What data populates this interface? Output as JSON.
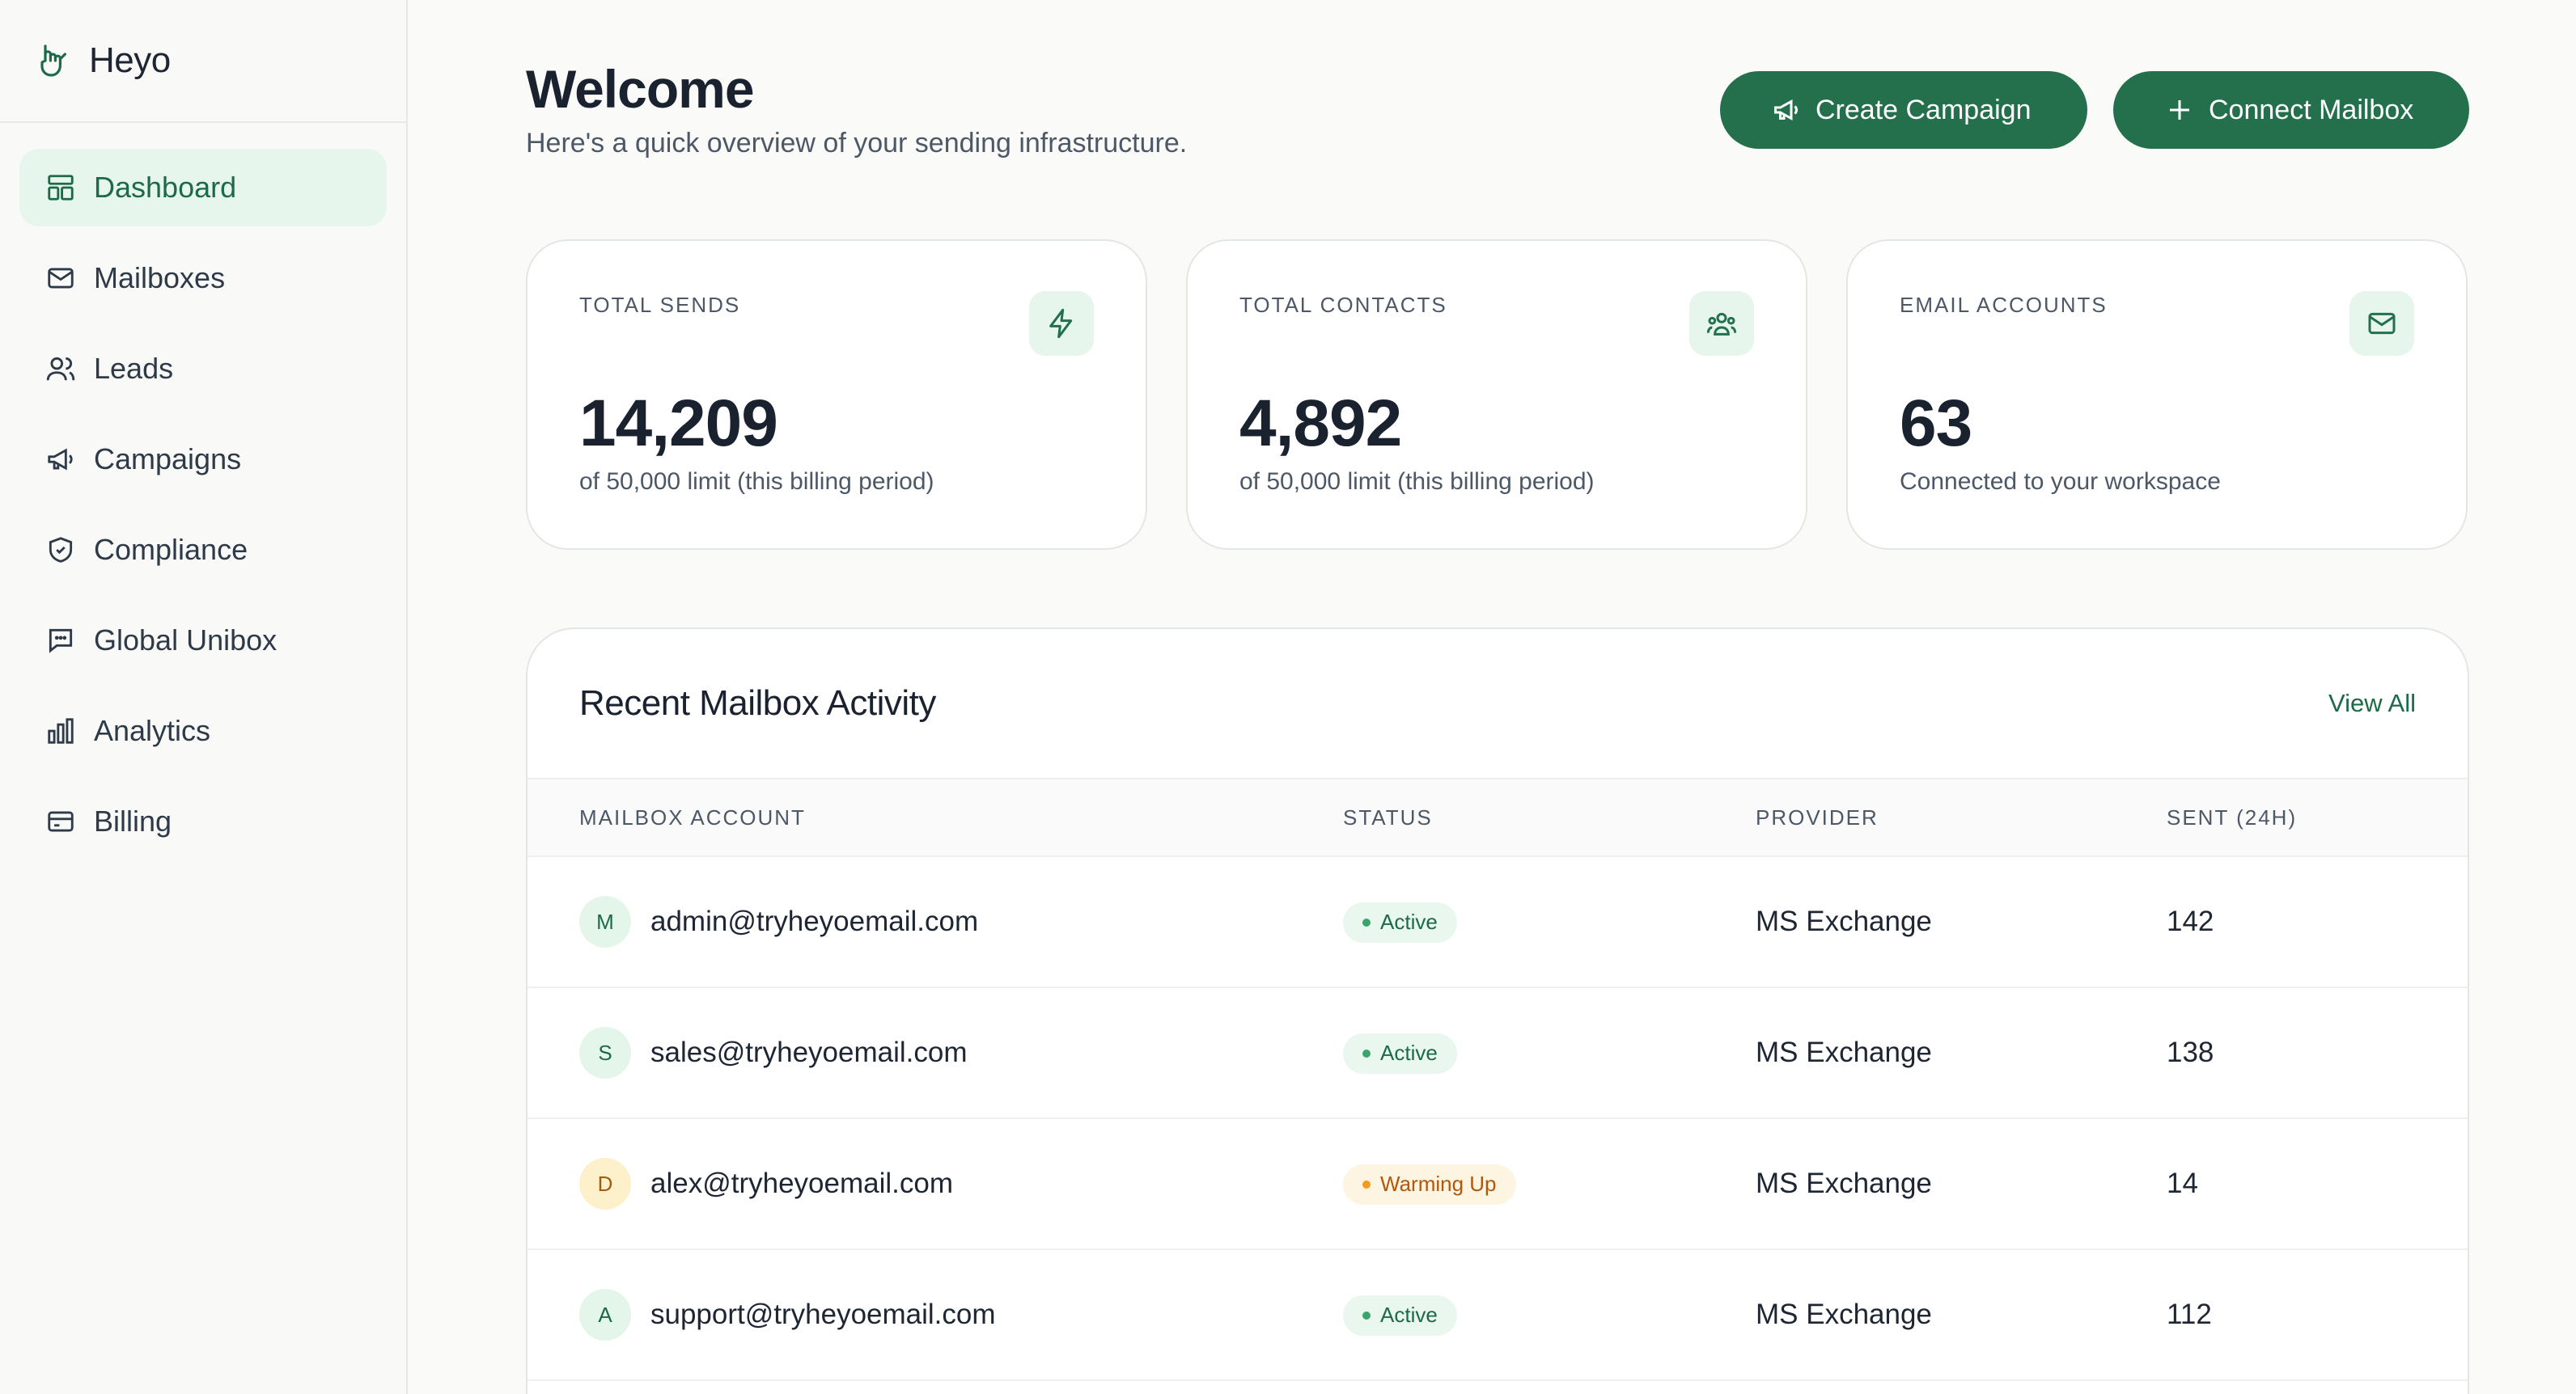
{
  "brand": {
    "name": "Heyo",
    "icon": "hand-icon"
  },
  "sidebar": {
    "items": [
      {
        "label": "Dashboard",
        "icon": "dashboard-icon",
        "active": true
      },
      {
        "label": "Mailboxes",
        "icon": "mail-icon"
      },
      {
        "label": "Leads",
        "icon": "users-icon"
      },
      {
        "label": "Campaigns",
        "icon": "megaphone-icon"
      },
      {
        "label": "Compliance",
        "icon": "shield-icon"
      },
      {
        "label": "Global Unibox",
        "icon": "chat-icon"
      },
      {
        "label": "Analytics",
        "icon": "bar-chart-icon"
      },
      {
        "label": "Billing",
        "icon": "credit-card-icon"
      }
    ]
  },
  "header": {
    "title": "Welcome",
    "subtitle": "Here's a quick overview of your sending infrastructure.",
    "create_label": "Create Campaign",
    "connect_label": "Connect Mailbox"
  },
  "stats": [
    {
      "label": "TOTAL SENDS",
      "value": "14,209",
      "sub": "of 50,000 limit (this billing period)",
      "icon": "lightning-icon"
    },
    {
      "label": "TOTAL CONTACTS",
      "value": "4,892",
      "sub": "of 50,000 limit (this billing period)",
      "icon": "users-group-icon"
    },
    {
      "label": "EMAIL ACCOUNTS",
      "value": "63",
      "sub": "Connected to your workspace",
      "icon": "envelope-icon"
    }
  ],
  "activity": {
    "title": "Recent Mailbox Activity",
    "view_all": "View All",
    "columns": [
      "MAILBOX ACCOUNT",
      "STATUS",
      "PROVIDER",
      "SENT (24H)"
    ],
    "rows": [
      {
        "initial": "M",
        "email": "admin@tryheyoemail.com",
        "status": "Active",
        "provider": "MS Exchange",
        "sent": "142"
      },
      {
        "initial": "S",
        "email": "sales@tryheyoemail.com",
        "status": "Active",
        "provider": "MS Exchange",
        "sent": "138"
      },
      {
        "initial": "D",
        "email": "alex@tryheyoemail.com",
        "status": "Warming Up",
        "provider": "MS Exchange",
        "sent": "14"
      },
      {
        "initial": "A",
        "email": "support@tryheyoemail.com",
        "status": "Active",
        "provider": "MS Exchange",
        "sent": "112"
      }
    ]
  },
  "colors": {
    "accent": "#24704d",
    "active_bg": "#e7f6ec",
    "warning": "#f29b1c"
  }
}
